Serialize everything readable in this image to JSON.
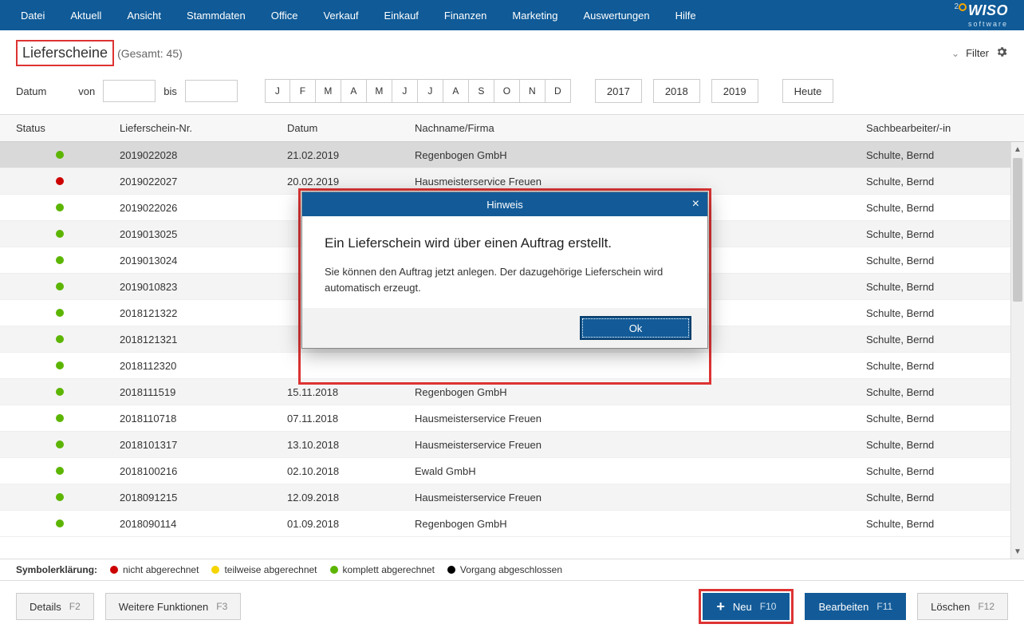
{
  "menu": {
    "items": [
      "Datei",
      "Aktuell",
      "Ansicht",
      "Stammdaten",
      "Office",
      "Verkauf",
      "Einkauf",
      "Finanzen",
      "Marketing",
      "Auswertungen",
      "Hilfe"
    ]
  },
  "brand": {
    "name": "WISO",
    "sub": "software",
    "num": "2"
  },
  "page": {
    "title": "Lieferscheine",
    "count_label": "(Gesamt: 45)"
  },
  "filter": {
    "label": "Filter",
    "date_label": "Datum",
    "from_label": "von",
    "to_label": "bis",
    "months": [
      "J",
      "F",
      "M",
      "A",
      "M",
      "J",
      "J",
      "A",
      "S",
      "O",
      "N",
      "D"
    ],
    "years": [
      "2017",
      "2018",
      "2019"
    ],
    "today": "Heute"
  },
  "table": {
    "headers": {
      "status": "Status",
      "nr": "Lieferschein-Nr.",
      "datum": "Datum",
      "name": "Nachname/Firma",
      "sach": "Sachbearbeiter/-in"
    },
    "rows": [
      {
        "status": "green",
        "nr": "2019022028",
        "datum": "21.02.2019",
        "name": "Regenbogen GmbH",
        "sach": "Schulte, Bernd",
        "sel": true
      },
      {
        "status": "red",
        "nr": "2019022027",
        "datum": "20.02.2019",
        "name": "Hausmeisterservice Freuen",
        "sach": "Schulte, Bernd"
      },
      {
        "status": "green",
        "nr": "2019022026",
        "datum": "",
        "name": "",
        "sach": "Schulte, Bernd"
      },
      {
        "status": "green",
        "nr": "2019013025",
        "datum": "",
        "name": "",
        "sach": "Schulte, Bernd"
      },
      {
        "status": "green",
        "nr": "2019013024",
        "datum": "",
        "name": "",
        "sach": "Schulte, Bernd"
      },
      {
        "status": "green",
        "nr": "2019010823",
        "datum": "",
        "name": "",
        "sach": "Schulte, Bernd"
      },
      {
        "status": "green",
        "nr": "2018121322",
        "datum": "",
        "name": "",
        "sach": "Schulte, Bernd"
      },
      {
        "status": "green",
        "nr": "2018121321",
        "datum": "",
        "name": "",
        "sach": "Schulte, Bernd"
      },
      {
        "status": "green",
        "nr": "2018112320",
        "datum": "",
        "name": "",
        "sach": "Schulte, Bernd"
      },
      {
        "status": "green",
        "nr": "2018111519",
        "datum": "15.11.2018",
        "name": "Regenbogen GmbH",
        "sach": "Schulte, Bernd"
      },
      {
        "status": "green",
        "nr": "2018110718",
        "datum": "07.11.2018",
        "name": "Hausmeisterservice Freuen",
        "sach": "Schulte, Bernd"
      },
      {
        "status": "green",
        "nr": "2018101317",
        "datum": "13.10.2018",
        "name": "Hausmeisterservice Freuen",
        "sach": "Schulte, Bernd"
      },
      {
        "status": "green",
        "nr": "2018100216",
        "datum": "02.10.2018",
        "name": "Ewald GmbH",
        "sach": "Schulte, Bernd"
      },
      {
        "status": "green",
        "nr": "2018091215",
        "datum": "12.09.2018",
        "name": "Hausmeisterservice Freuen",
        "sach": "Schulte, Bernd"
      },
      {
        "status": "green",
        "nr": "2018090114",
        "datum": "01.09.2018",
        "name": "Regenbogen GmbH",
        "sach": "Schulte, Bernd"
      }
    ]
  },
  "legend": {
    "title": "Symbolerklärung:",
    "items": [
      {
        "color": "red",
        "label": "nicht abgerechnet"
      },
      {
        "color": "yellow",
        "label": "teilweise abgerechnet"
      },
      {
        "color": "green",
        "label": "komplett abgerechnet"
      },
      {
        "color": "black",
        "label": "Vorgang abgeschlossen"
      }
    ]
  },
  "buttons": {
    "details": {
      "label": "Details",
      "fkey": "F2"
    },
    "more": {
      "label": "Weitere Funktionen",
      "fkey": "F3"
    },
    "neu": {
      "label": "Neu",
      "fkey": "F10"
    },
    "edit": {
      "label": "Bearbeiten",
      "fkey": "F11"
    },
    "delete": {
      "label": "Löschen",
      "fkey": "F12"
    }
  },
  "dialog": {
    "title": "Hinweis",
    "heading": "Ein Lieferschein wird über einen Auftrag erstellt.",
    "text": "Sie können den Auftrag jetzt anlegen. Der dazugehörige Lieferschein wird automatisch erzeugt.",
    "ok": "Ok"
  }
}
